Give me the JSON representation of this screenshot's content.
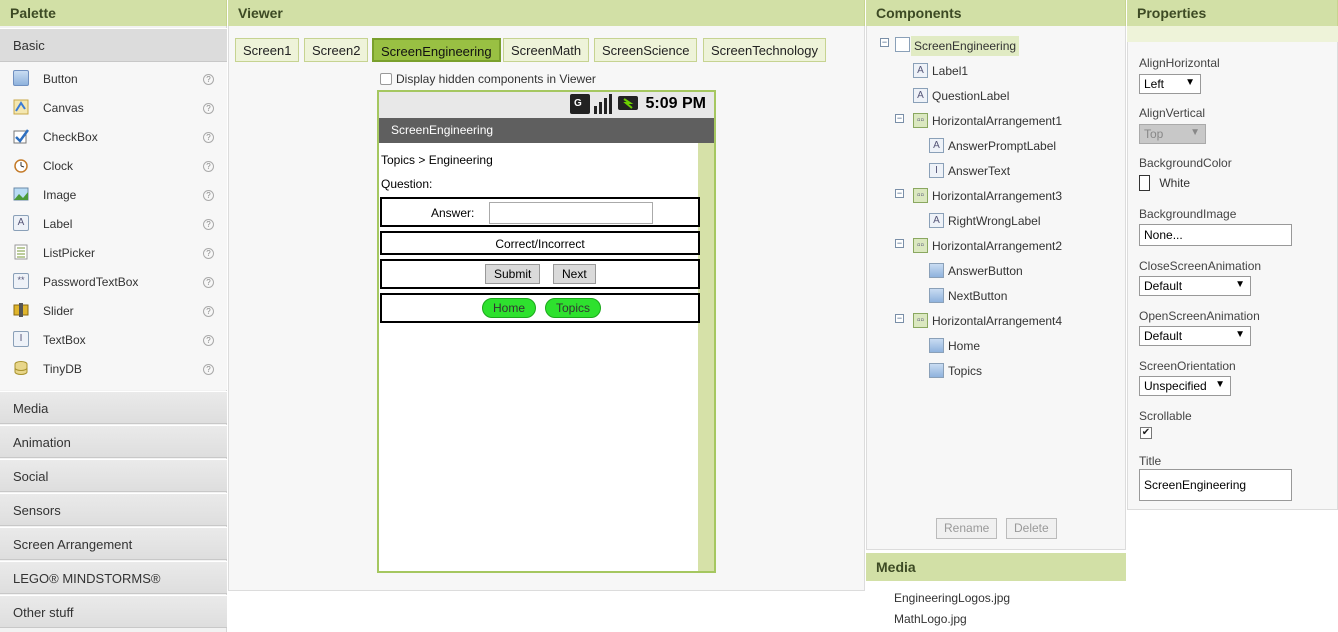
{
  "palette": {
    "title": "Palette",
    "basic_label": "Basic",
    "items": [
      {
        "label": "Button",
        "icon": "button-icon",
        "help": "?"
      },
      {
        "label": "Canvas",
        "icon": "canvas-icon",
        "help": "?"
      },
      {
        "label": "CheckBox",
        "icon": "checkbox-icon",
        "help": "?"
      },
      {
        "label": "Clock",
        "icon": "clock-icon",
        "help": "?"
      },
      {
        "label": "Image",
        "icon": "image-icon",
        "help": "?"
      },
      {
        "label": "Label",
        "icon": "label-icon",
        "help": "?"
      },
      {
        "label": "ListPicker",
        "icon": "listpicker-icon",
        "help": "?"
      },
      {
        "label": "PasswordTextBox",
        "icon": "password-icon",
        "help": "?"
      },
      {
        "label": "Slider",
        "icon": "slider-icon",
        "help": "?"
      },
      {
        "label": "TextBox",
        "icon": "textbox-icon",
        "help": "?"
      },
      {
        "label": "TinyDB",
        "icon": "database-icon",
        "help": "?"
      }
    ],
    "groups": [
      "Media",
      "Animation",
      "Social",
      "Sensors",
      "Screen Arrangement",
      "LEGO® MINDSTORMS®",
      "Other stuff"
    ]
  },
  "viewer": {
    "title": "Viewer",
    "tabs": [
      "Screen1",
      "Screen2",
      "ScreenEngineering",
      "ScreenMath",
      "ScreenScience",
      "ScreenTechnology"
    ],
    "active_tab": "ScreenEngineering",
    "hidden_toggle": "Display hidden components in Viewer",
    "phone": {
      "time": "5:09 PM",
      "screen_title": "ScreenEngineering",
      "breadcrumb": "Topics > Engineering",
      "question": "Question:",
      "answer_label": "Answer:",
      "result": "Correct/Incorrect",
      "submit": "Submit",
      "next": "Next",
      "home": "Home",
      "topics": "Topics"
    }
  },
  "components": {
    "title": "Components",
    "tree": {
      "root": "ScreenEngineering",
      "label1": "Label1",
      "question_label": "QuestionLabel",
      "ha1": "HorizontalArrangement1",
      "answer_prompt": "AnswerPromptLabel",
      "answer_text": "AnswerText",
      "ha3": "HorizontalArrangement3",
      "right_wrong": "RightWrongLabel",
      "ha2": "HorizontalArrangement2",
      "answer_button": "AnswerButton",
      "next_button": "NextButton",
      "ha4": "HorizontalArrangement4",
      "home": "Home",
      "topics": "Topics"
    },
    "rename": "Rename",
    "delete": "Delete",
    "media_title": "Media",
    "media_files": [
      "EngineeringLogos.jpg",
      "MathLogo.jpg"
    ]
  },
  "properties": {
    "title": "Properties",
    "align_h_label": "AlignHorizontal",
    "align_h": "Left",
    "align_v_label": "AlignVertical",
    "align_v": "Top",
    "bg_color_label": "BackgroundColor",
    "bg_color": "White",
    "bg_image_label": "BackgroundImage",
    "bg_image": "None...",
    "close_anim_label": "CloseScreenAnimation",
    "close_anim": "Default",
    "open_anim_label": "OpenScreenAnimation",
    "open_anim": "Default",
    "orientation_label": "ScreenOrientation",
    "orientation": "Unspecified",
    "scrollable_label": "Scrollable",
    "scrollable": true,
    "title_label": "Title",
    "title_value": "ScreenEngineering"
  },
  "colors": {
    "header_bg": "#d2e0a6",
    "active_tab": "#99c043",
    "green_button": "#2ee12e"
  }
}
